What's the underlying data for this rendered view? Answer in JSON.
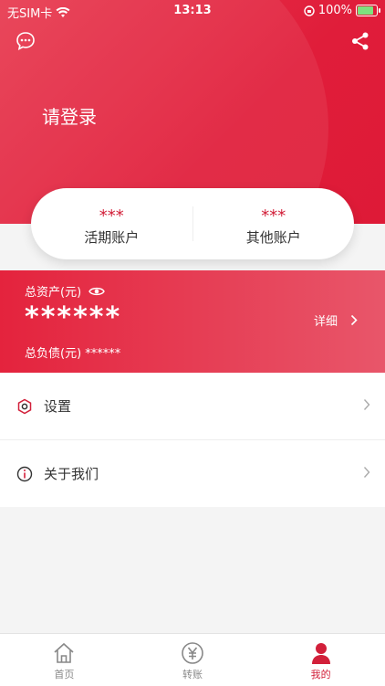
{
  "status_bar": {
    "carrier": "无SIM卡",
    "time": "13:13",
    "battery": "100%"
  },
  "header": {
    "login_text": "请登录",
    "message_icon": "chat-icon",
    "share_icon": "share-icon"
  },
  "accounts": [
    {
      "value": "***",
      "label": "活期账户"
    },
    {
      "value": "***",
      "label": "其他账户"
    }
  ],
  "assets": {
    "total_label": "总资产(元)",
    "total_value": "******",
    "detail_label": "详细",
    "liability_label": "总负债(元) ******"
  },
  "menu": [
    {
      "label": "设置",
      "icon": "settings-icon"
    },
    {
      "label": "关于我们",
      "icon": "info-icon"
    }
  ],
  "tabs": [
    {
      "label": "首页",
      "icon": "home-icon",
      "active": false
    },
    {
      "label": "转账",
      "icon": "yen-icon",
      "active": false
    },
    {
      "label": "我的",
      "icon": "user-icon",
      "active": true
    }
  ],
  "colors": {
    "brand_red": "#e01d3a",
    "active_tab": "#d2203a"
  }
}
